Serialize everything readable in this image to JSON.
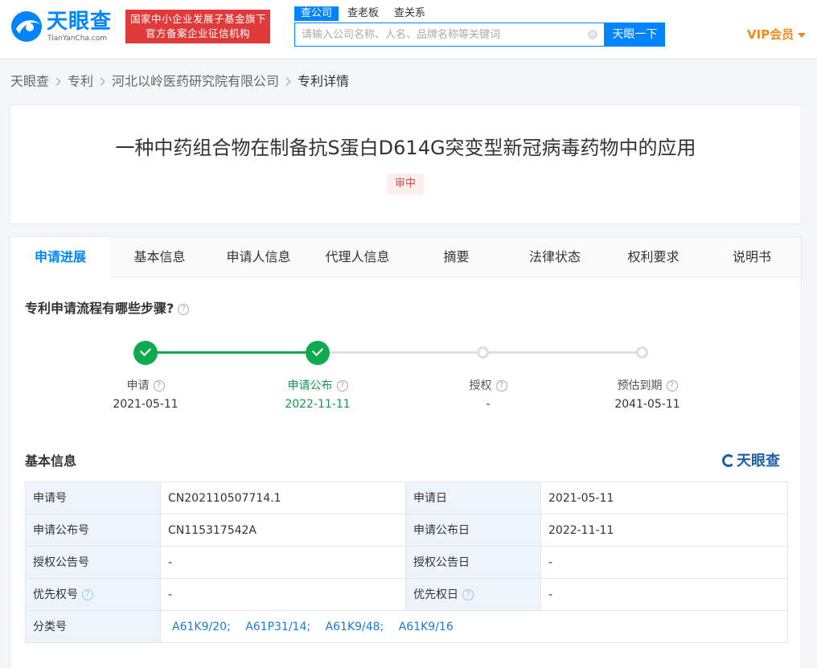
{
  "header": {
    "logo_cn": "天眼查",
    "logo_en": "TianYanCha.com",
    "banner_line1": "国家中小企业发展子基金旗下",
    "banner_line2": "官方备案企业征信机构",
    "search_tabs": [
      "查公司",
      "查老板",
      "查关系"
    ],
    "search_placeholder": "请输入公司名称、人名、品牌名称等关键词",
    "search_button": "天眼一下",
    "vip_label": "VIP会员"
  },
  "breadcrumb": {
    "items": [
      "天眼查",
      "专利",
      "河北以岭医药研究院有限公司"
    ],
    "current": "专利详情"
  },
  "patent": {
    "title": "一种中药组合物在制备抗S蛋白D614G突变型新冠病毒药物中的应用",
    "status": "审中"
  },
  "tabs": [
    "申请进展",
    "基本信息",
    "申请人信息",
    "代理人信息",
    "摘要",
    "法律状态",
    "权利要求",
    "说明书"
  ],
  "progress": {
    "title": "专利申请流程有哪些步骤?",
    "steps": [
      {
        "label": "申请",
        "date": "2021-05-11",
        "done": true
      },
      {
        "label": "申请公布",
        "date": "2022-11-11",
        "done": true
      },
      {
        "label": "授权",
        "date": "-",
        "done": false
      },
      {
        "label": "预估到期",
        "date": "2041-05-11",
        "done": false
      }
    ]
  },
  "basic_info": {
    "title": "基本信息",
    "brand": "天眼查",
    "rows": [
      {
        "l1": "申请号",
        "v1": "CN202110507714.1",
        "l2": "申请日",
        "v2": "2021-05-11"
      },
      {
        "l1": "申请公布号",
        "v1": "CN115317542A",
        "l2": "申请公布日",
        "v2": "2022-11-11"
      },
      {
        "l1": "授权公告号",
        "v1": "-",
        "l2": "授权公告日",
        "v2": "-"
      },
      {
        "l1": "优先权号",
        "v1": "-",
        "l2": "优先权日",
        "v2": "-"
      }
    ],
    "class_label": "分类号",
    "classes": [
      "A61K9/20;",
      "A61P31/14;",
      "A61K9/48;",
      "A61K9/16"
    ]
  },
  "colors": {
    "brand_blue": "#0084ff",
    "done_green": "#0fa950",
    "status_red": "#e44a4a",
    "vip_orange": "#f08a1d"
  }
}
